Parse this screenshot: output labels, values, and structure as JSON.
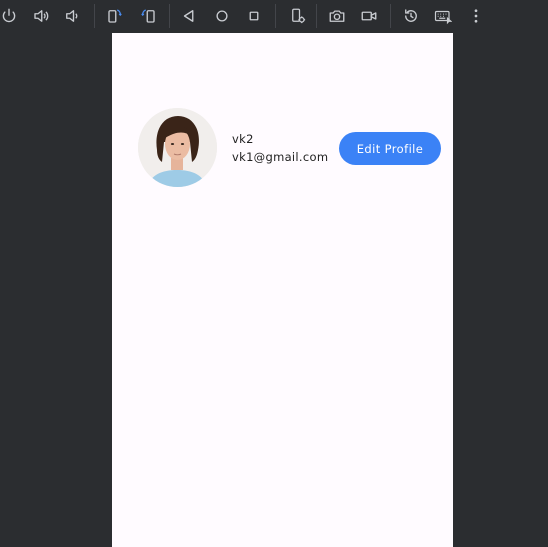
{
  "toolbar": {
    "icons": [
      "power-icon",
      "volume-up-icon",
      "volume-down-icon",
      "rotate-left-icon",
      "rotate-right-icon",
      "back-icon",
      "home-icon",
      "overview-icon",
      "device-settings-icon",
      "camera-icon",
      "video-icon",
      "replay-icon",
      "keyboard-icon",
      "more-icon"
    ],
    "accent": "#4a8cf0",
    "icon_color": "#c9ccd1"
  },
  "profile": {
    "name": "vk2",
    "email": "vk1@gmail.com",
    "edit_label": "Edit Profile",
    "button_color": "#3b82f6"
  }
}
